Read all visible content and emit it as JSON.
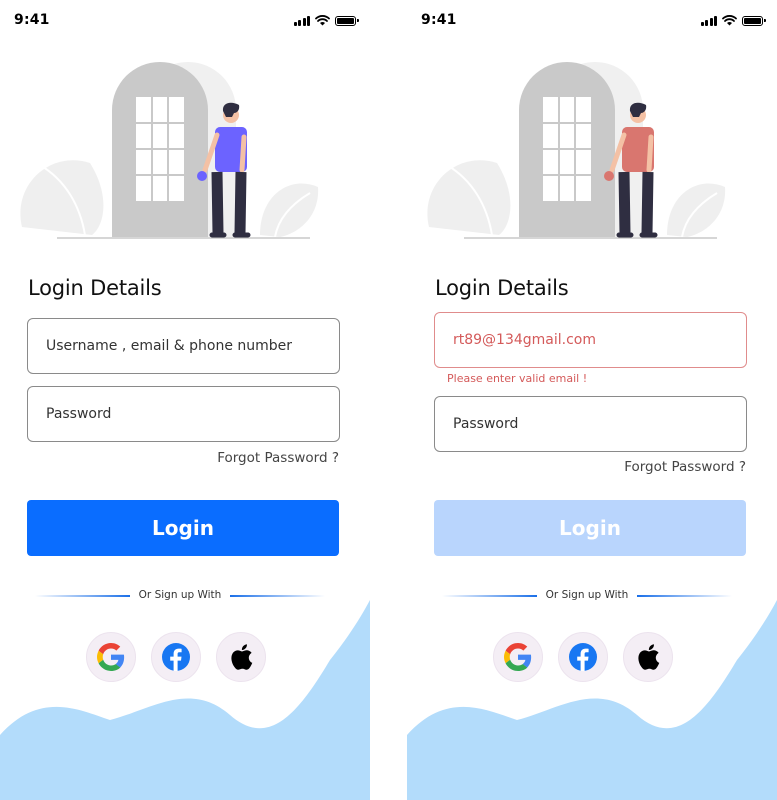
{
  "status": {
    "time": "9:41"
  },
  "screens": [
    {
      "title": "Login Details",
      "username_placeholder": "Username , email & phone number",
      "password_placeholder": "Password",
      "forgot": "Forgot Password ?",
      "login_label": "Login",
      "divider_text": "Or Sign up With",
      "state": "default",
      "person_shirt_color": "#6c63ff"
    },
    {
      "title": "Login Details",
      "username_value": "rt89@134gmail.com",
      "error_message": "Please enter valid email !",
      "password_placeholder": "Password",
      "forgot": "Forgot Password ?",
      "login_label": "Login",
      "divider_text": "Or Sign up With",
      "state": "error",
      "person_shirt_color": "#d9766f"
    }
  ],
  "icons": [
    "google-icon",
    "facebook-icon",
    "apple-icon"
  ],
  "colors": {
    "primary": "#0a6dff",
    "primary_disabled": "#b9d5fd",
    "error": "#d45a5a",
    "wave": "#b3dcfb"
  }
}
